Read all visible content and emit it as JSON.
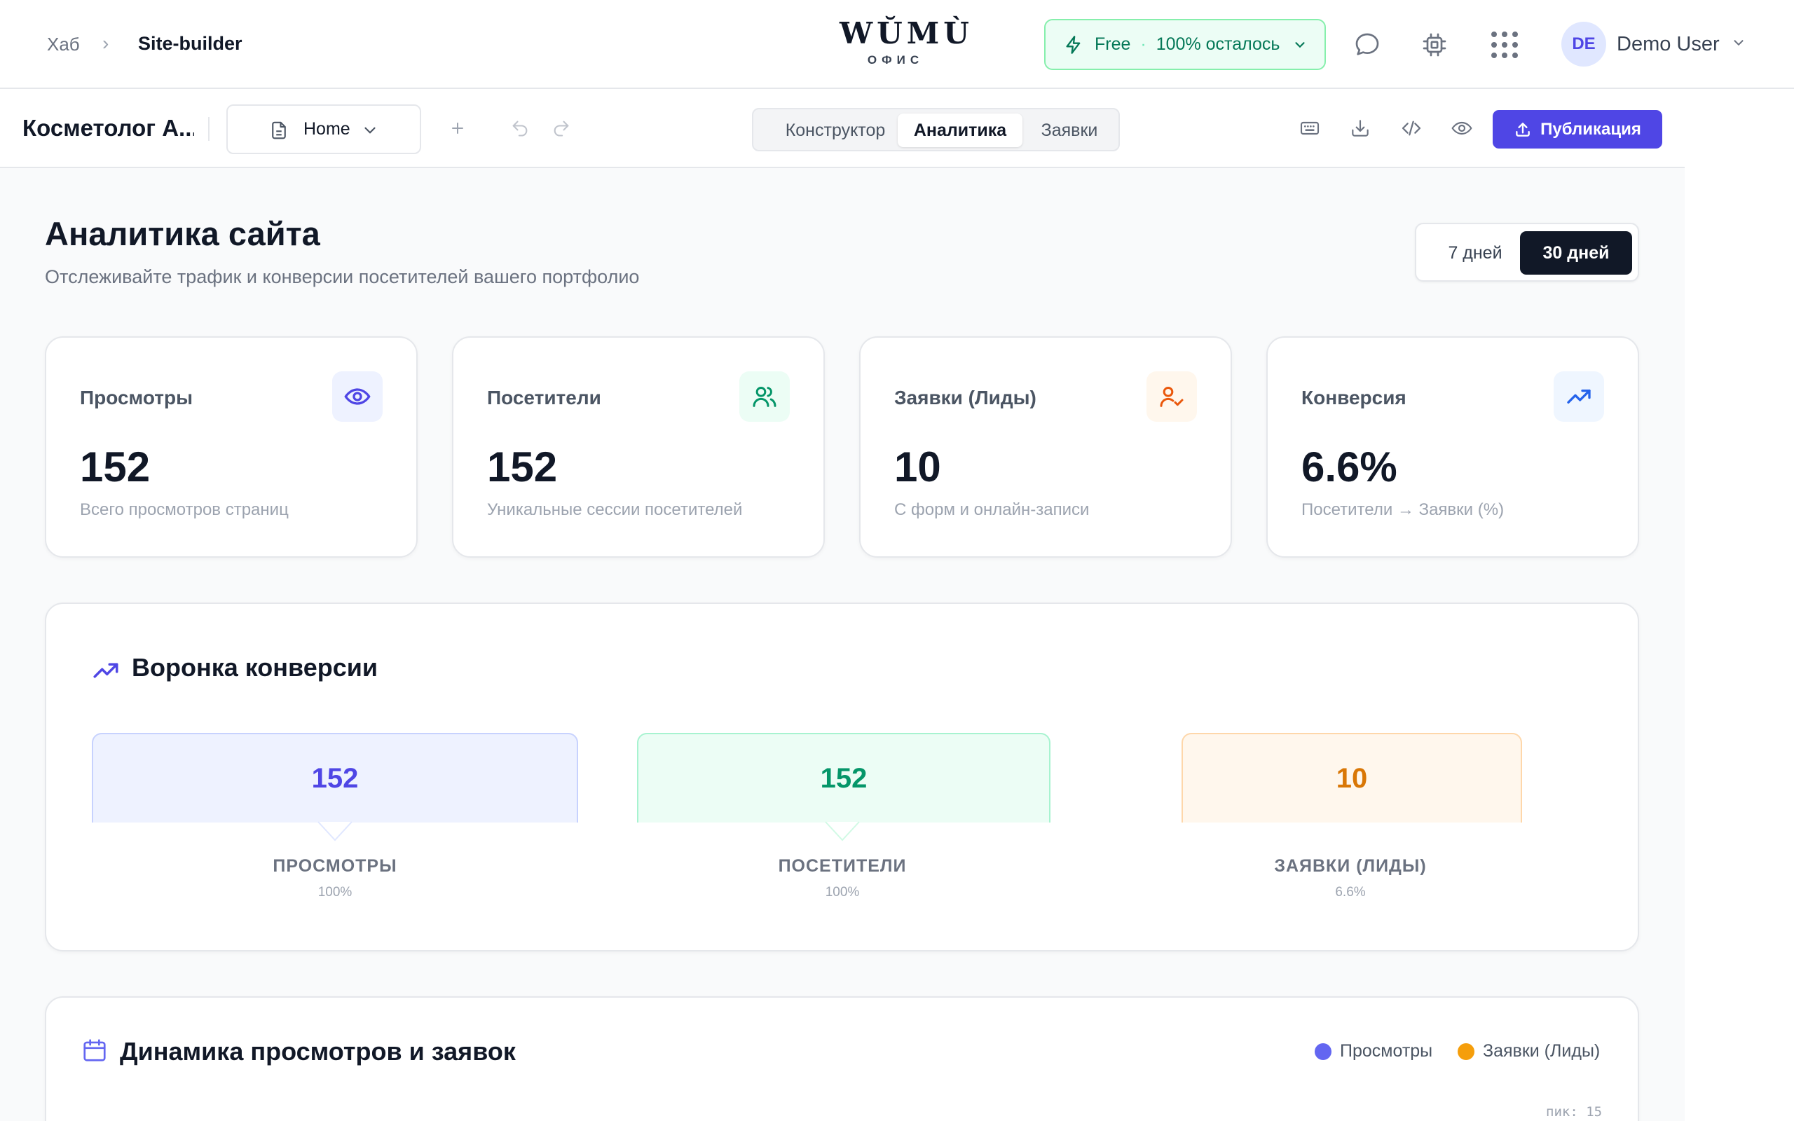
{
  "header": {
    "breadcrumb": {
      "hub": "Хаб",
      "separator": "›",
      "current": "Site-builder"
    },
    "logo": {
      "main": "WŬMÙ",
      "sub": "ОФИС"
    },
    "plan": {
      "name": "Free",
      "separator": "·",
      "remaining": "100% осталось",
      "icon": "lightning-icon"
    },
    "icons": [
      "chat-bubble-icon",
      "chip-icon",
      "apps-grid-icon"
    ],
    "user": {
      "initials": "DE",
      "name": "Demo User"
    }
  },
  "toolbar": {
    "site_name": "Косметолог А...",
    "page_select": "Home",
    "tabs": [
      {
        "label": "Конструктор",
        "active": false
      },
      {
        "label": "Аналитика",
        "active": true
      },
      {
        "label": "Заявки",
        "active": false
      }
    ],
    "publish_label": "Публикация",
    "accent": "#4f46e5"
  },
  "analytics": {
    "title": "Аналитика сайта",
    "subtitle": "Отслеживайте трафик и конверсии посетителей вашего портфолио",
    "ranges": [
      {
        "label": "7 дней",
        "active": false
      },
      {
        "label": "30 дней",
        "active": true
      }
    ],
    "stats": [
      {
        "label": "Просмотры",
        "value": "152",
        "note": "Всего просмотров страниц",
        "icon": "eye-icon",
        "icon_bg": "#eef2ff",
        "icon_color": "#4f46e5"
      },
      {
        "label": "Посетители",
        "value": "152",
        "note": "Уникальные сессии посетителей",
        "icon": "users-icon",
        "icon_bg": "#ecfdf5",
        "icon_color": "#059669"
      },
      {
        "label": "Заявки (Лиды)",
        "value": "10",
        "note": "С форм и онлайн-записи",
        "icon": "user-check-icon",
        "icon_bg": "#fff7ed",
        "icon_color": "#ea580c"
      },
      {
        "label": "Конверсия",
        "value": "6.6%",
        "note": "Посетители → Заявки (%)",
        "icon": "trending-up-icon",
        "icon_bg": "#eff6ff",
        "icon_color": "#2563eb"
      }
    ]
  },
  "funnel": {
    "title": "Воронка конверсии",
    "steps": [
      {
        "value": "152",
        "label": "ПРОСМОТРЫ",
        "pct": "100%",
        "color": "#4f46e5",
        "bg": "#eef2ff",
        "border": "#c7d2fe"
      },
      {
        "value": "152",
        "label": "ПОСЕТИТЕЛИ",
        "pct": "100%",
        "color": "#059669",
        "bg": "#ecfdf5",
        "border": "#a7f3d0"
      },
      {
        "value": "10",
        "label": "ЗАЯВКИ (ЛИДЫ)",
        "pct": "6.6%",
        "color": "#d97706",
        "bg": "#fff7ed",
        "border": "#fed7aa"
      }
    ]
  },
  "dynamics": {
    "title": "Динамика просмотров и заявок",
    "legend": [
      {
        "label": "Просмотры",
        "color": "#6366f1"
      },
      {
        "label": "Заявки (Лиды)",
        "color": "#f59e0b"
      }
    ],
    "peak": "пик: 15"
  }
}
